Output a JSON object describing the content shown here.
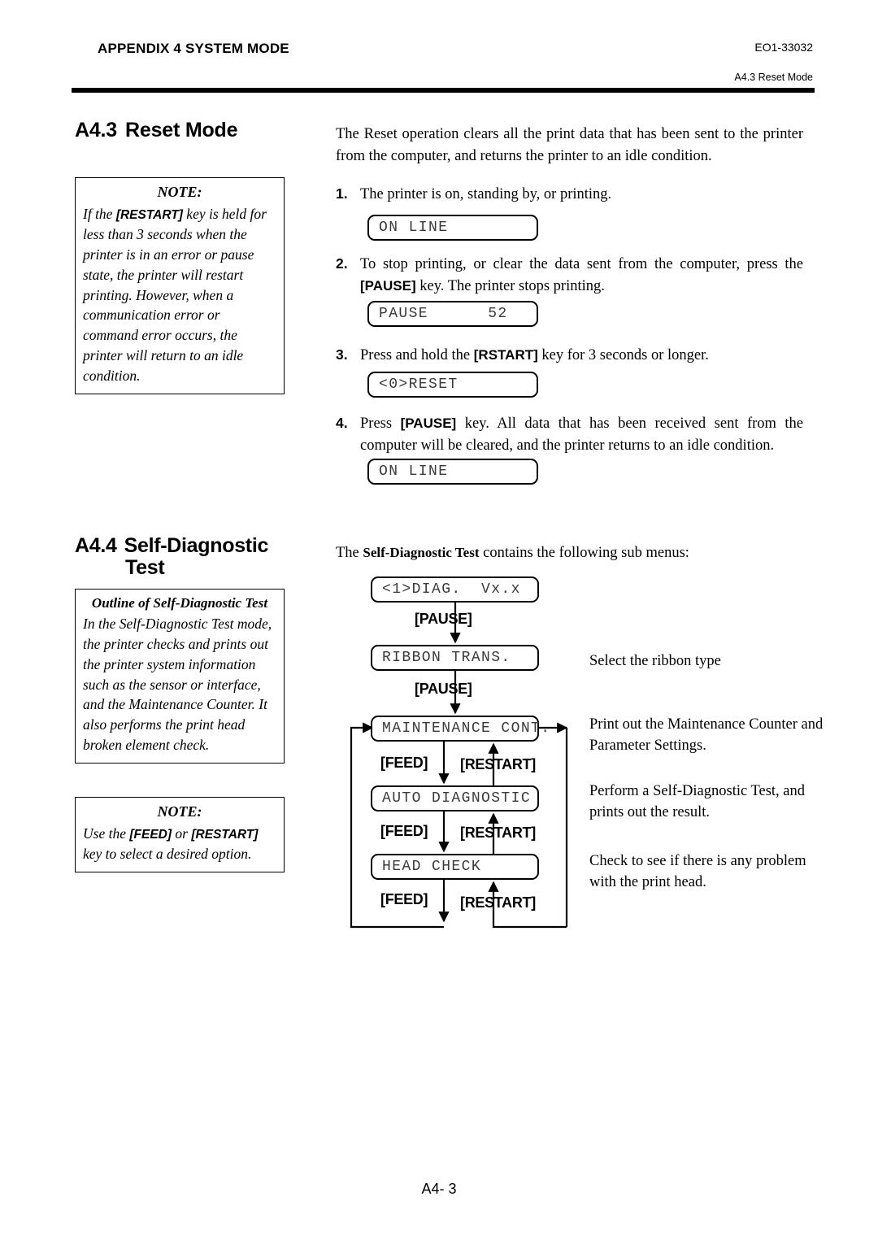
{
  "header": {
    "title": "APPENDIX 4 SYSTEM MODE",
    "doc_code": "EO1-33032",
    "subtitle": "A4.3 Reset Mode"
  },
  "sections": {
    "reset": {
      "number": "A4.3",
      "title": "Reset Mode",
      "intro": "The Reset operation clears all the print data that has been sent to the printer from the computer, and returns the printer to an idle condition.",
      "steps": [
        {
          "num": "1.",
          "text": "The printer is on, standing by, or printing."
        },
        {
          "num": "2.",
          "text": "To stop printing, or clear the data sent from the computer, press the [PAUSE] key.  The printer stops printing."
        },
        {
          "num": "3.",
          "text": "Press and hold the [RSTART] key for 3 seconds or longer."
        },
        {
          "num": "4.",
          "text": "Press [PAUSE] key.  All data that has been received sent from the computer will be cleared, and the printer returns to an idle condition."
        }
      ],
      "lcd": {
        "online1": "ON LINE",
        "pause": "PAUSE      52",
        "reset": "<0>RESET",
        "online2": "ON LINE"
      }
    },
    "selfdiag": {
      "number": "A4.4",
      "title_line1": "Self-Diagnostic",
      "title_line2": "Test",
      "intro": "The Self-Diagnostic Test contains the following sub menus:"
    }
  },
  "notes": {
    "restart": {
      "heading": "NOTE:",
      "body": "If the [RESTART] key is held for less than 3 seconds when the printer is in an error or pause state, the printer will restart printing.  However, when a communication error or command error occurs, the printer will return to an idle condition."
    },
    "outline": {
      "heading": "Outline of Self-Diagnostic Test",
      "body": "In the Self-Diagnostic Test mode, the printer checks and prints out  the printer system information such as the sensor or interface, and the Maintenance Counter.  It also performs the print head broken element check."
    },
    "feed": {
      "heading": "NOTE:",
      "body": "Use the [FEED] or [RESTART] key to select a desired option."
    }
  },
  "flowchart": {
    "boxes": {
      "diag": "<1>DIAG.  Vx.x",
      "ribbon": "RIBBON TRANS.",
      "maintenance": "MAINTENANCE CONT.",
      "auto": "AUTO DIAGNOSTIC",
      "head": "HEAD CHECK"
    },
    "keys": {
      "pause1": "[PAUSE]",
      "pause2": "[PAUSE]",
      "feed1": "[FEED]",
      "restart1": "[RESTART]",
      "feed2": "[FEED]",
      "restart2": "[RESTART]",
      "feed3": "[FEED]",
      "restart3": "[RESTART]"
    },
    "annotations": {
      "ribbon": "Select the ribbon type",
      "maintenance": "Print out the Maintenance Counter and Parameter Settings.",
      "auto": "Perform a Self-Diagnostic Test, and prints out the result.",
      "head": "Check to see if there is any problem with the print head."
    }
  },
  "footer": {
    "page": "A4- 3"
  }
}
